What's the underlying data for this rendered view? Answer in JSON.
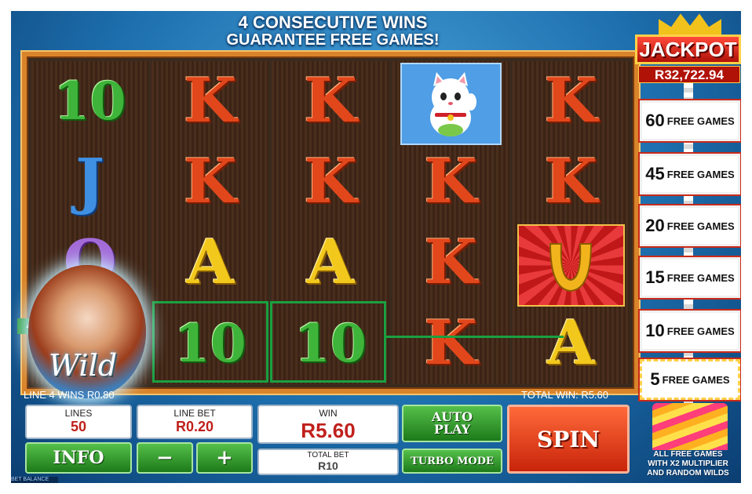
{
  "banner": {
    "line1": "4 CONSECUTIVE WINS",
    "line2": "GUARANTEE FREE GAMES!"
  },
  "reels": [
    [
      "10",
      "J",
      "Q",
      ""
    ],
    [
      "K",
      "K",
      "A",
      "10"
    ],
    [
      "K",
      "K",
      "A",
      "10"
    ],
    [
      "",
      "K",
      "K",
      "K"
    ],
    [
      "K",
      "K",
      "",
      "A"
    ]
  ],
  "wild": {
    "text": "Wild"
  },
  "payline": {
    "number": "4"
  },
  "status": {
    "line_win": "LINE 4 WINS R0.80",
    "total_win": "TOTAL WIN: R5.60"
  },
  "controls": {
    "lines_label": "LINES",
    "lines_value": "50",
    "linebet_label": "LINE BET",
    "linebet_value": "R0.20",
    "win_label": "WIN",
    "win_value": "R5.60",
    "totalbet_label": "TOTAL BET",
    "totalbet_value": "R10",
    "info_label": "INFO",
    "minus_label": "−",
    "plus_label": "+",
    "autoplay_label": "AUTO PLAY",
    "turbo_label": "TURBO MODE",
    "spin_label": "SPIN"
  },
  "jackpot": {
    "title": "JACKPOT",
    "amount": "R32,722.94",
    "free_games": [
      {
        "n": "60",
        "label": "FREE GAMES"
      },
      {
        "n": "45",
        "label": "FREE GAMES"
      },
      {
        "n": "20",
        "label": "FREE GAMES"
      },
      {
        "n": "15",
        "label": "FREE GAMES"
      },
      {
        "n": "10",
        "label": "FREE GAMES"
      },
      {
        "n": "5",
        "label": "FREE GAMES"
      }
    ],
    "note_line1": "ALL FREE GAMES",
    "note_line2": "WITH X2 MULTIPLIER",
    "note_line3": "AND RANDOM WILDS"
  },
  "footer": {
    "balance_label": "BET BALANCE"
  },
  "colors": {
    "reel_frame": "#d9842a",
    "win_line": "#1aa041",
    "spin": "#e8401a",
    "jackpot_red": "#d0201a"
  }
}
